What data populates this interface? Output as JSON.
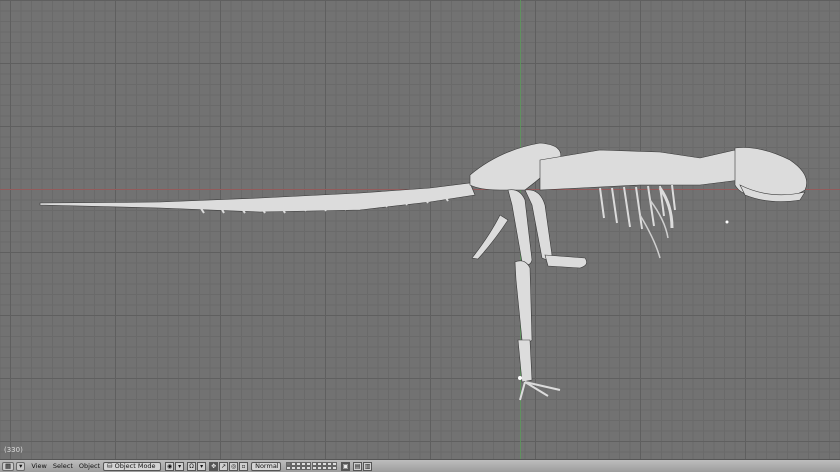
{
  "viewport": {
    "frame_label": "(330)",
    "axis_x_color": "#a05a5a",
    "axis_y_color": "#5a9a5a",
    "skeleton_color": "#dcdcdc",
    "background": "#727272"
  },
  "header": {
    "menus": [
      {
        "label": "View"
      },
      {
        "label": "Select"
      },
      {
        "label": "Object"
      }
    ],
    "mode_dropdown": "Object Mode",
    "pivot_dropdown": "Normal",
    "icons": [
      "window-type-icon",
      "menu-collapse-icon",
      "draw-type-icon",
      "pivot-icon",
      "manipulator-icon",
      "translate-icon",
      "rotate-icon",
      "scale-icon",
      "lock-icon",
      "render-icon"
    ]
  }
}
